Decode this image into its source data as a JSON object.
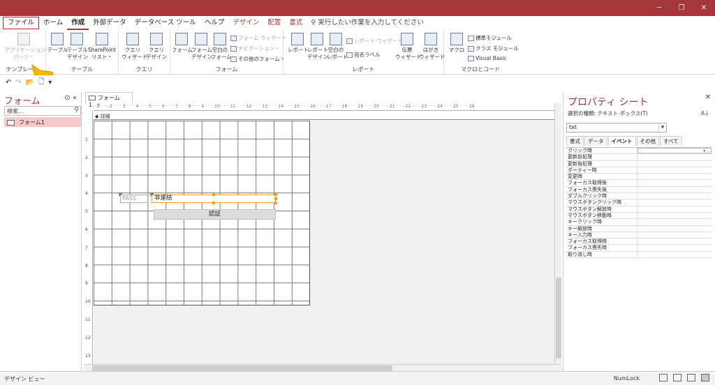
{
  "window": {
    "minimize": "─",
    "restore": "❐",
    "close": "✕"
  },
  "ribbon_tabs": [
    "ファイル",
    "ホーム",
    "作成",
    "外部データ",
    "データベース ツール",
    "ヘルプ",
    "デザイン",
    "配置",
    "書式"
  ],
  "tell_me": "⚲ 実行したい作業を入力してください",
  "groups": {
    "templates": {
      "title": "テンプレート",
      "app_parts": "アプリケーション\nパーツ・"
    },
    "tables": {
      "title": "テーブル",
      "table": "テーブル",
      "table_design": "テーブル\nデザイン",
      "sharepoint": "SharePoint\nリスト・"
    },
    "queries": {
      "title": "クエリ",
      "wizard": "クエリ\nウィザード",
      "design": "クエリ\nデザイン"
    },
    "forms": {
      "title": "フォーム",
      "form": "フォーム",
      "form_design": "フォーム\nデザイン",
      "blank_form": "空白の\nフォーム",
      "form_wizard": "フォーム ウィザード",
      "navigation": "ナビゲーション・",
      "more_forms": "その他のフォーム・"
    },
    "reports": {
      "title": "レポート",
      "report": "レポート",
      "report_design": "レポート\nデザイン",
      "blank_report": "空白の\nレポート",
      "report_wizard": "レポート ウィザード",
      "labels": "宛名ラベル",
      "slip_wizard": "伝票\nウィザード",
      "postcard_wizard": "はがき\nウィザード"
    },
    "macros": {
      "title": "マクロとコード",
      "macro": "マクロ",
      "module": "標準モジュール",
      "class_module": "クラス モジュール",
      "vba": "Visual Basic"
    }
  },
  "qat": {
    "undo": "↶",
    "redo": "↷",
    "open": "📂",
    "new": "🗋",
    "more": "▾"
  },
  "nav": {
    "title": "フォーム",
    "search_placeholder": "検索...",
    "items": [
      "フォーム1"
    ]
  },
  "document": {
    "tab": "フォーム1",
    "ruler": "· 1 · · · 2 · · · 3 · · · 4 · · · 5 · · · 6 · · · 7 · · · 8 · · · 9 · · · 10 · · · 11 · · · 12 · · · 13 · · · 14 · · · 15 · · · 16 · · · 17 · · · 18 · · · 19 · · · 20 · · · 21 · · · 22 · · · 23 · · · 24 · · · 25 · · · 26",
    "vruler": [
      "1",
      "2",
      "3",
      "4",
      "5",
      "6",
      "7",
      "8",
      "9",
      "10",
      "11",
      "12",
      "13"
    ],
    "section": "詳細",
    "label": "PASS",
    "textbox": "非連結",
    "button": "認証"
  },
  "props": {
    "title": "プロパティ シート",
    "selection": "選択の種類: テキスト ボックス(T)",
    "sort_icon": "A↓",
    "combo": "txt",
    "tabs": [
      "書式",
      "データ",
      "イベント",
      "その他",
      "すべて"
    ],
    "active_tab": "イベント",
    "rows": [
      "クリック時",
      "更新前処理",
      "更新後処理",
      "ダーティー時",
      "変更時",
      "フォーカス取得後",
      "フォーカス喪失後",
      "ダブルクリック時",
      "マウスボタンクリック時",
      "マウスボタン解放時",
      "マウスボタン移動時",
      "キークリック時",
      "キー解放時",
      "キー入力時",
      "フォーカス取得時",
      "フォーカス喪失時",
      "取り消し時"
    ]
  },
  "status": {
    "left": "デザイン ビュー",
    "numlock": "NumLock"
  }
}
